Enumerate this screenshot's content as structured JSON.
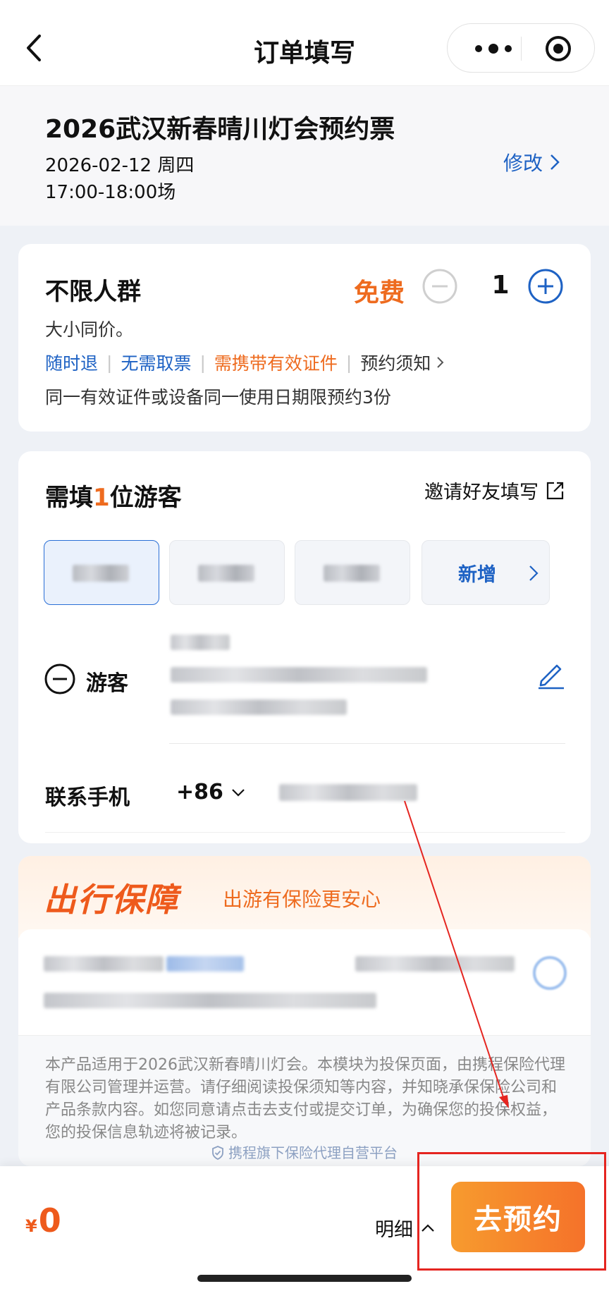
{
  "header": {
    "title": "订单填写"
  },
  "product": {
    "name": "2026武汉新春晴川灯会预约票",
    "date": "2026-02-12 周四",
    "session": "17:00-18:00场",
    "modify_label": "修改"
  },
  "ticket": {
    "name": "不限人群",
    "price": "免费",
    "quantity": "1",
    "description": "大小同价。",
    "tags": {
      "refund": "随时退",
      "no_pickup": "无需取票",
      "id_required": "需携带有效证件",
      "notice": "预约须知"
    },
    "limit": "同一有效证件或设备同一使用日期限预约3份",
    "colors": {
      "accent": "#ee6b1f",
      "link": "#1e62c4"
    }
  },
  "traveler": {
    "need_prefix": "需填",
    "need_count": "1",
    "need_suffix": "位游客",
    "invite_label": "邀请好友填写",
    "add_label": "新增",
    "guest_label": "游客",
    "phone_label": "联系手机",
    "country_code": "+86"
  },
  "insurance": {
    "brand": "出行保障",
    "slogan": "出游有保险更安心",
    "notice": "本产品适用于2026武汉新春晴川灯会。本模块为投保页面，由携程保险代理有限公司管理并运营。请仔细阅读投保须知等内容，并知晓承保保险公司和产品条款内容。如您同意请点击去支付或提交订单，为确保您的投保权益，您的投保信息轨迹将被记录。",
    "platform": "携程旗下保险代理自营平台"
  },
  "bottom_bar": {
    "currency": "¥",
    "total": "0",
    "detail_label": "明细",
    "book_label": "去预约"
  }
}
